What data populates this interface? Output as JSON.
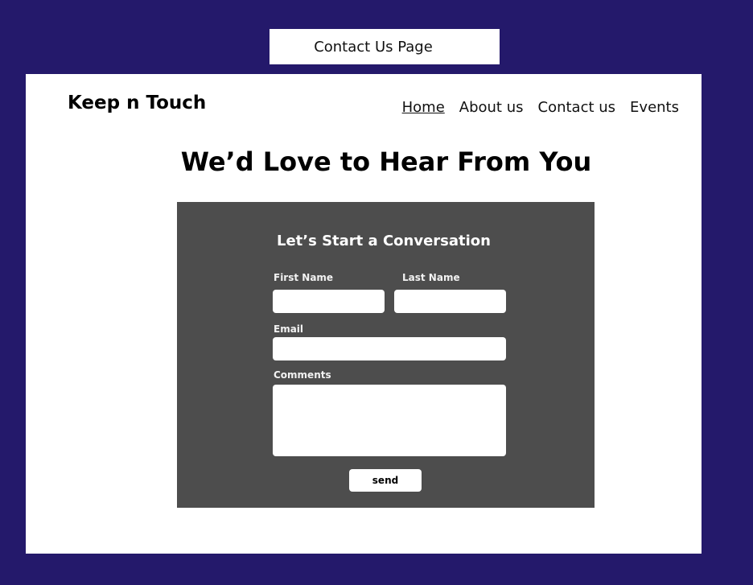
{
  "page_label": "Contact Us Page",
  "brand": "Keep n Touch",
  "nav": {
    "items": [
      {
        "label": "Home",
        "active": true
      },
      {
        "label": "About us",
        "active": false
      },
      {
        "label": "Contact us",
        "active": false
      },
      {
        "label": "Events",
        "active": false
      }
    ]
  },
  "headline": "We’d Love to Hear From You",
  "form": {
    "title": "Let’s Start a Conversation",
    "first_name_label": "First Name",
    "first_name_value": "",
    "last_name_label": "Last Name",
    "last_name_value": "",
    "email_label": "Email",
    "email_value": "",
    "comments_label": "Comments",
    "comments_value": "",
    "send_label": "send"
  },
  "colors": {
    "background": "#24196b",
    "frame": "#ffffff",
    "form_panel": "#4d4d4d"
  }
}
